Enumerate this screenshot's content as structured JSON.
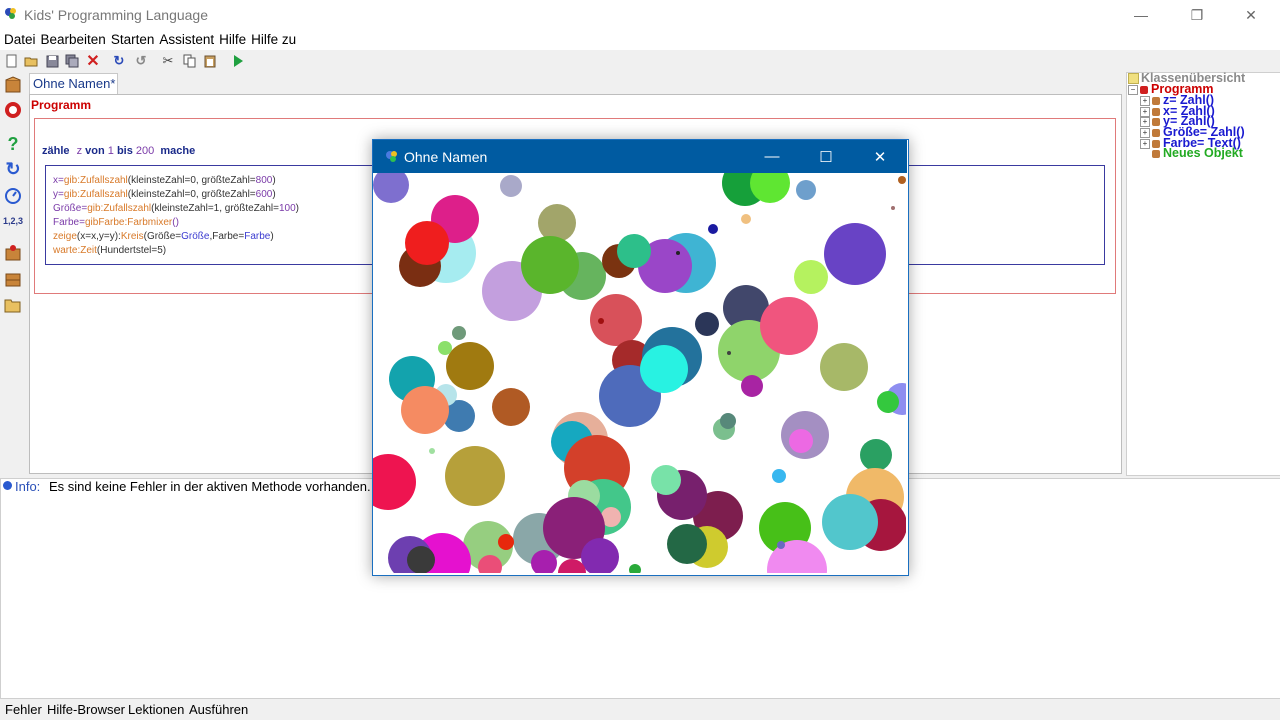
{
  "window": {
    "title": "Kids' Programming Language",
    "minimize_glyph": "—",
    "maximize_glyph": "❐",
    "close_glyph": "✕"
  },
  "menu": [
    "Datei",
    "Bearbeiten",
    "Starten",
    "Assistent",
    "Hilfe",
    "Hilfe zu"
  ],
  "toolbar_icons": [
    "new-file-icon",
    "open-folder-icon",
    "save-icon",
    "save-all-icon",
    "delete-icon",
    "undo-icon",
    "redo-icon",
    "cut-icon",
    "copy-icon",
    "paste-icon",
    "run-icon"
  ],
  "left_toolbar_icons": [
    "package-icon",
    "gear-icon",
    "help-icon",
    "refresh-icon",
    "timer-icon",
    "numbers-icon",
    "object-package-icon",
    "package-stack-icon",
    "folder-open-icon"
  ],
  "editor": {
    "tab_label": "Ohne Namen*",
    "program_label": "Programm",
    "loop": {
      "kw_count": "zähle",
      "var": "z",
      "kw_from": "von",
      "from": "1",
      "kw_to": "bis",
      "to": "200",
      "kw_do": "mache"
    },
    "code_lines": [
      [
        "x=",
        "gib",
        ":",
        "Zufallszahl",
        "(kleinsteZahl=0, größteZahl=",
        "800",
        ")"
      ],
      [
        "y=",
        "gib",
        ":",
        "Zufallszahl",
        "(kleinsteZahl=0, größteZahl=",
        "600",
        ")"
      ],
      [
        "Größe=",
        "gib",
        ":",
        "Zufallszahl",
        "(kleinsteZahl=1, größteZahl=",
        "100",
        ")"
      ],
      [
        "Farbe=",
        "gib",
        "Farbe",
        ":",
        "Farbmixer",
        "()"
      ],
      [
        "zeige",
        "(x=x,y=y):",
        "Kreis",
        "(Größe=",
        "Größe",
        ",Farbe=",
        "Farbe",
        ")"
      ],
      [
        "warte",
        ":",
        "Zeit",
        "(Hundertstel=5)"
      ]
    ]
  },
  "class_panel": {
    "title": "Klassenübersicht",
    "root": "Programm",
    "members": [
      "z= Zahl()",
      "x= Zahl()",
      "y= Zahl()",
      "Größe= Zahl()",
      "Farbe= Text()"
    ],
    "new_object": "Neues Objekt"
  },
  "info": {
    "label": "Info:",
    "message": "Es sind keine Fehler in der aktiven Methode vorhanden."
  },
  "bottom_tabs": [
    "Fehler",
    "Hilfe-Browser",
    "Lektionen",
    "Ausführen"
  ],
  "popup": {
    "title": "Ohne Namen",
    "minimize_glyph": "—",
    "maximize_glyph": "☐",
    "close_glyph": "✕"
  },
  "colors": {
    "program_red": "#cc0000",
    "member_blue": "#1a1ad0",
    "new_object_green": "#22aa22",
    "popup_titlebar": "#005ba1"
  }
}
